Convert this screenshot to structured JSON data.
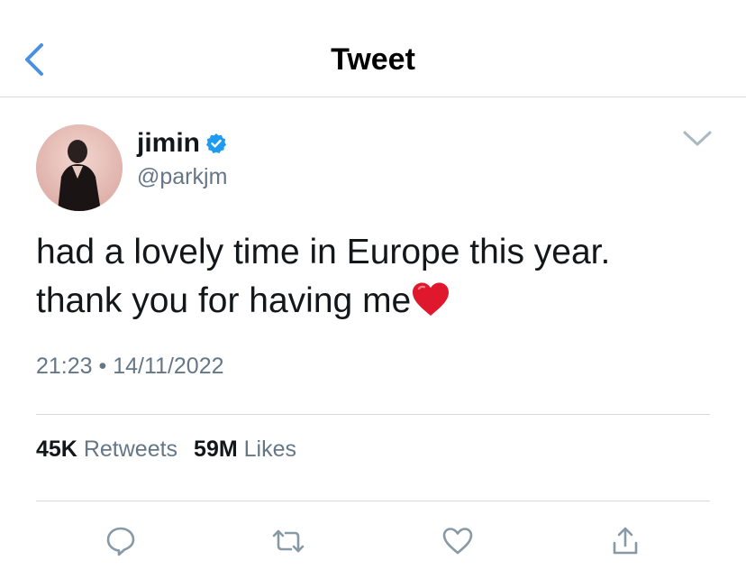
{
  "header": {
    "title": "Tweet",
    "back_icon": "chevron-left-icon"
  },
  "tweet": {
    "author": {
      "display_name": "jimin",
      "handle": "@parkjm",
      "verified": true
    },
    "text_lines": [
      "had a lovely time in Europe this year.",
      "thank you for having me"
    ],
    "emoji": "red-heart",
    "time": "21:23",
    "separator": "•",
    "date": "14/11/2022",
    "stats": {
      "retweets_count": "45K",
      "retweets_label": "Retweets",
      "likes_count": "59M",
      "likes_label": "Likes"
    },
    "actions": [
      "reply-icon",
      "retweet-icon",
      "like-icon",
      "share-icon"
    ]
  },
  "colors": {
    "accent": "#4a90e2",
    "verified": "#1d9bf0",
    "text": "#14171a",
    "muted": "#657786",
    "divider": "#d6d9dc",
    "heart": "#e0182d"
  }
}
